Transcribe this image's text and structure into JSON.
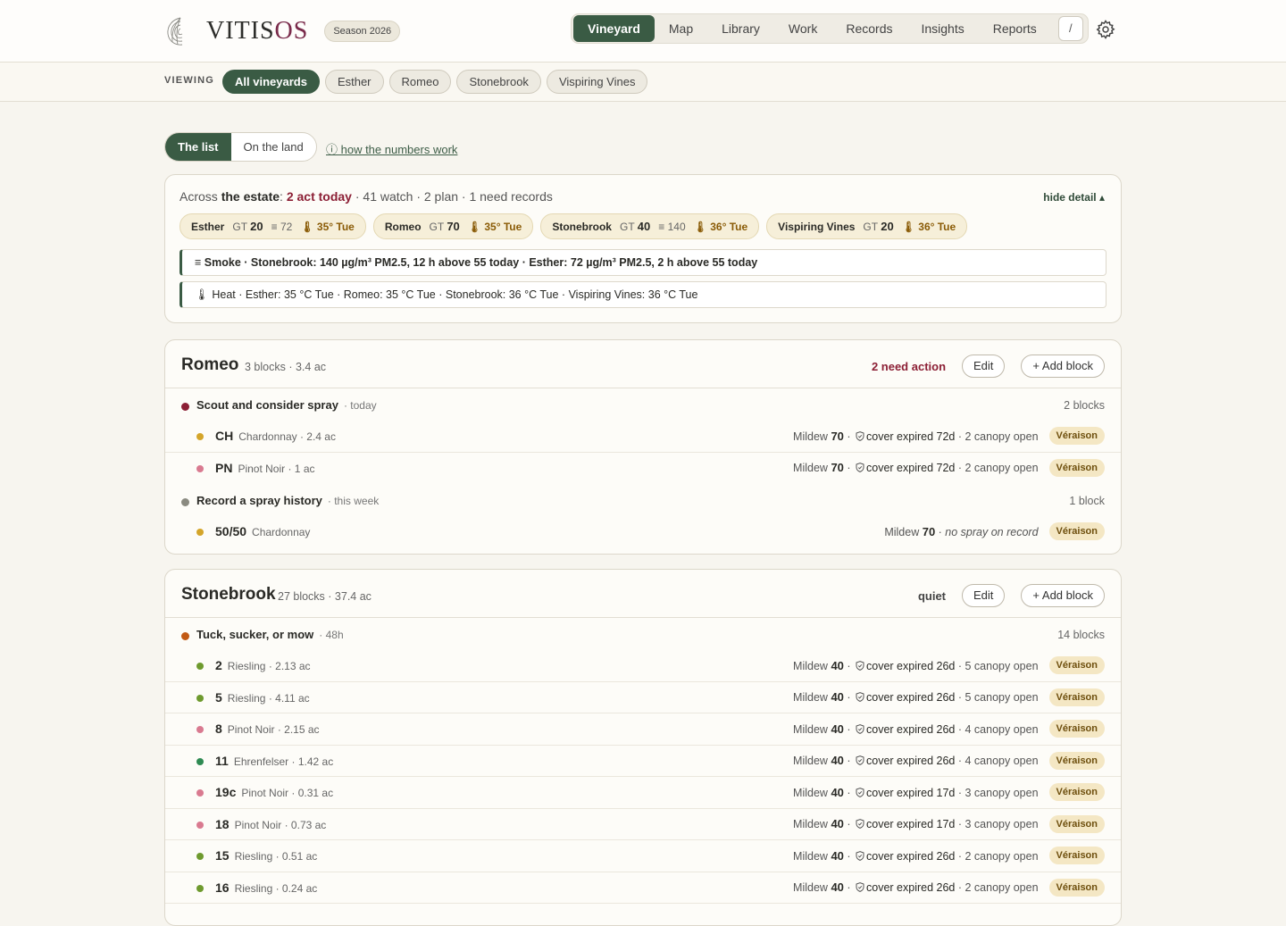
{
  "app": {
    "logo_main": "VITIS",
    "logo_accent": "OS",
    "season": "Season 2026"
  },
  "nav": {
    "items": [
      "Vineyard",
      "Map",
      "Library",
      "Work",
      "Records",
      "Insights",
      "Reports"
    ],
    "active": "Vineyard",
    "shortcut": "/"
  },
  "viewing": {
    "label": "VIEWING",
    "chips": [
      "All vineyards",
      "Esther",
      "Romeo",
      "Stonebrook",
      "Vispiring Vines"
    ],
    "active": "All vineyards"
  },
  "toggle": {
    "list": "The list",
    "land": "On the land"
  },
  "how_link": "ⓘ how the numbers work",
  "estate": {
    "prefix": "Across ",
    "name": "the estate",
    "colon": ": ",
    "act": "2 act today",
    "rest": " · 41 watch · 2 plan · 1 need records",
    "hide_detail": "hide detail ▴",
    "vineyards": [
      {
        "name": "Esther",
        "gt": "20",
        "smoke": "72",
        "heat": "35° Tue"
      },
      {
        "name": "Romeo",
        "gt": "70",
        "smoke": "",
        "heat": "35° Tue"
      },
      {
        "name": "Stonebrook",
        "gt": "40",
        "smoke": "140",
        "heat": "36° Tue"
      },
      {
        "name": "Vispiring Vines",
        "gt": "20",
        "smoke": "",
        "heat": "36° Tue"
      }
    ],
    "smoke_alert": "Smoke · Stonebrook: 140 µg/m³ PM2.5, 12 h above 55 today · Esther: 72 µg/m³ PM2.5, 2 h above 55 today",
    "heat_alert": "Heat · Esther: 35 °C Tue · Romeo: 35 °C Tue · Stonebrook: 36 °C Tue · Vispiring Vines: 36 °C Tue"
  },
  "romeo": {
    "name": "Romeo",
    "meta": "3 blocks · 3.4 ac",
    "status": "2 need action",
    "edit": "Edit",
    "add": "+ Add block",
    "tasks": [
      {
        "title": "Scout and consider spray",
        "when": "· today",
        "count": "2 blocks",
        "dot": "#8c1f35",
        "blocks": [
          {
            "code": "CH",
            "variety": "Chardonnay · 2.4 ac",
            "dot": "#d4a52a",
            "mildew": "70",
            "cover": "cover expired 72d",
            "tail": "· 2 canopy open",
            "stage": "Véraison"
          },
          {
            "code": "PN",
            "variety": "Pinot Noir · 1 ac",
            "dot": "#d97a90",
            "mildew": "70",
            "cover": "cover expired 72d",
            "tail": "· 2 canopy open",
            "stage": "Véraison"
          }
        ]
      },
      {
        "title": "Record a spray history",
        "when": "· this week",
        "count": "1 block",
        "dot": "#8a8a80",
        "blocks": [
          {
            "code": "50/50",
            "variety": "Chardonnay",
            "dot": "#d4a52a",
            "mildew": "70",
            "note": "no spray on record",
            "stage": "Véraison"
          }
        ]
      }
    ]
  },
  "stonebrook": {
    "name": "Stonebrook",
    "meta": "27 blocks · 37.4 ac",
    "status": "quiet",
    "edit": "Edit",
    "add": "+ Add block",
    "task": {
      "title": "Tuck, sucker, or mow",
      "when": "· 48h",
      "count": "14 blocks",
      "dot": "#c25a14",
      "blocks": [
        {
          "code": "2",
          "variety": "Riesling · 2.13 ac",
          "dot": "#6e9a2e",
          "mildew": "40",
          "cover": "cover expired 26d",
          "tail": "· 5 canopy open",
          "stage": "Véraison"
        },
        {
          "code": "5",
          "variety": "Riesling · 4.11 ac",
          "dot": "#6e9a2e",
          "mildew": "40",
          "cover": "cover expired 26d",
          "tail": "· 5 canopy open",
          "stage": "Véraison"
        },
        {
          "code": "8",
          "variety": "Pinot Noir · 2.15 ac",
          "dot": "#d97a90",
          "mildew": "40",
          "cover": "cover expired 26d",
          "tail": "· 4 canopy open",
          "stage": "Véraison"
        },
        {
          "code": "11",
          "variety": "Ehrenfelser · 1.42 ac",
          "dot": "#2e8a52",
          "mildew": "40",
          "cover": "cover expired 26d",
          "tail": "· 4 canopy open",
          "stage": "Véraison"
        },
        {
          "code": "19c",
          "variety": "Pinot Noir · 0.31 ac",
          "dot": "#d97a90",
          "mildew": "40",
          "cover": "cover expired 17d",
          "tail": "· 3 canopy open",
          "stage": "Véraison"
        },
        {
          "code": "18",
          "variety": "Pinot Noir · 0.73 ac",
          "dot": "#d97a90",
          "mildew": "40",
          "cover": "cover expired 17d",
          "tail": "· 3 canopy open",
          "stage": "Véraison"
        },
        {
          "code": "15",
          "variety": "Riesling · 0.51 ac",
          "dot": "#6e9a2e",
          "mildew": "40",
          "cover": "cover expired 26d",
          "tail": "· 2 canopy open",
          "stage": "Véraison"
        },
        {
          "code": "16",
          "variety": "Riesling · 0.24 ac",
          "dot": "#6e9a2e",
          "mildew": "40",
          "cover": "cover expired 26d",
          "tail": "· 2 canopy open",
          "stage": "Véraison"
        }
      ]
    }
  },
  "labels": {
    "mildew": "Mildew",
    "gt": "GT"
  }
}
